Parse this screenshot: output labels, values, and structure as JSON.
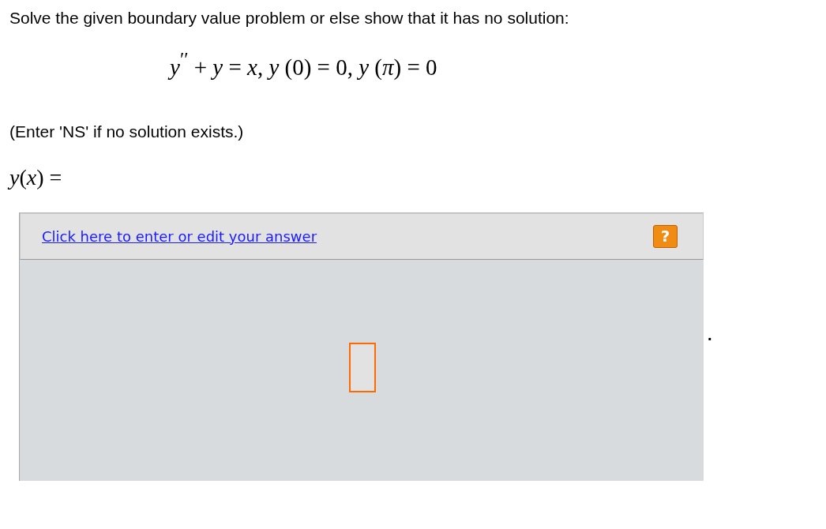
{
  "question": "Solve the given boundary value problem or else show that it has no solution:",
  "equation": "*y*$^{′′}$ + *y* = *x*,  *y* (0) = 0,  *y* (*π*) = 0",
  "hint": "(Enter 'NS' if no solution exists.)",
  "answer_label": "*y*(*x*) =",
  "answer_panel": {
    "link": "Click here to enter or edit your answer",
    "help": "?",
    "field": {
      "kind": "empty"
    }
  },
  "trailing_mark": "."
}
